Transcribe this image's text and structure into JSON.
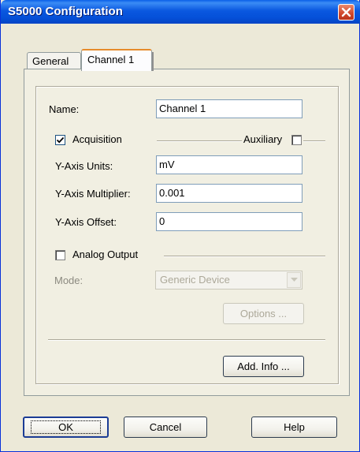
{
  "window": {
    "title": "S5000 Configuration"
  },
  "tabs": [
    {
      "label": "General"
    },
    {
      "label": "Channel 1"
    }
  ],
  "channel": {
    "name_label": "Name:",
    "name_value": "Channel 1",
    "acquisition_label": "Acquisition",
    "acquisition_checked": true,
    "auxiliary_label": "Auxiliary",
    "auxiliary_checked": false,
    "y_units_label": "Y-Axis Units:",
    "y_units_value": "mV",
    "y_multiplier_label": "Y-Axis Multiplier:",
    "y_multiplier_value": "0.001",
    "y_offset_label": "Y-Axis Offset:",
    "y_offset_value": "0",
    "analog_output_label": "Analog Output",
    "analog_output_checked": false,
    "mode_label": "Mode:",
    "mode_value": "Generic Device",
    "options_label": "Options ...",
    "add_info_label": "Add. Info ..."
  },
  "footer": {
    "ok_label": "OK",
    "cancel_label": "Cancel",
    "help_label": "Help"
  },
  "icons": {
    "close": "close-icon",
    "check": "checkmark-icon",
    "dropdown": "chevron-down-icon"
  },
  "colors": {
    "titlebar": "#0a58e0",
    "close_button": "#d0462a",
    "active_tab_accent": "#e68b2c"
  }
}
